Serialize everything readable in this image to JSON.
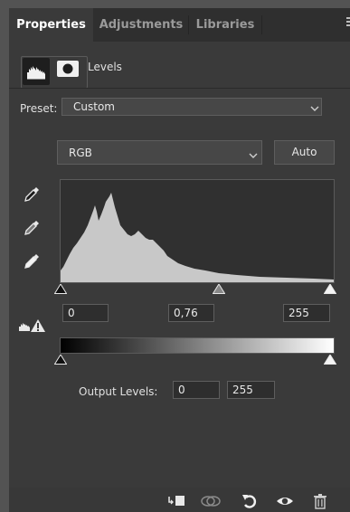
{
  "tabs": [
    {
      "label": "Properties",
      "active": true
    },
    {
      "label": "Adjustments",
      "active": false
    },
    {
      "label": "Libraries",
      "active": false
    }
  ],
  "panel_menu_icon": "menu-icon",
  "header": {
    "title": "Levels",
    "icons": [
      "levels-adjustment-icon",
      "layer-mask-icon"
    ]
  },
  "preset": {
    "label": "Preset:",
    "value": "Custom"
  },
  "channel": {
    "value": "RGB"
  },
  "auto_label": "Auto",
  "eyedroppers": [
    "black-point-eyedropper-icon",
    "gray-point-eyedropper-icon",
    "white-point-eyedropper-icon"
  ],
  "input_levels": {
    "black": "0",
    "midtone": "0,76",
    "white": "255"
  },
  "output_levels": {
    "label": "Output Levels:",
    "black": "0",
    "white": "255"
  },
  "bottom_toolbar": [
    "clip-to-layer-icon",
    "view-previous-state-icon",
    "reset-icon",
    "visibility-eye-icon",
    "trash-icon"
  ],
  "colors": {
    "panel_bg": "#3a3a3a",
    "tab_bg": "#2f2f2f",
    "histogram_fill": "#c8c8c8",
    "field_bg": "#2e2e2e"
  }
}
